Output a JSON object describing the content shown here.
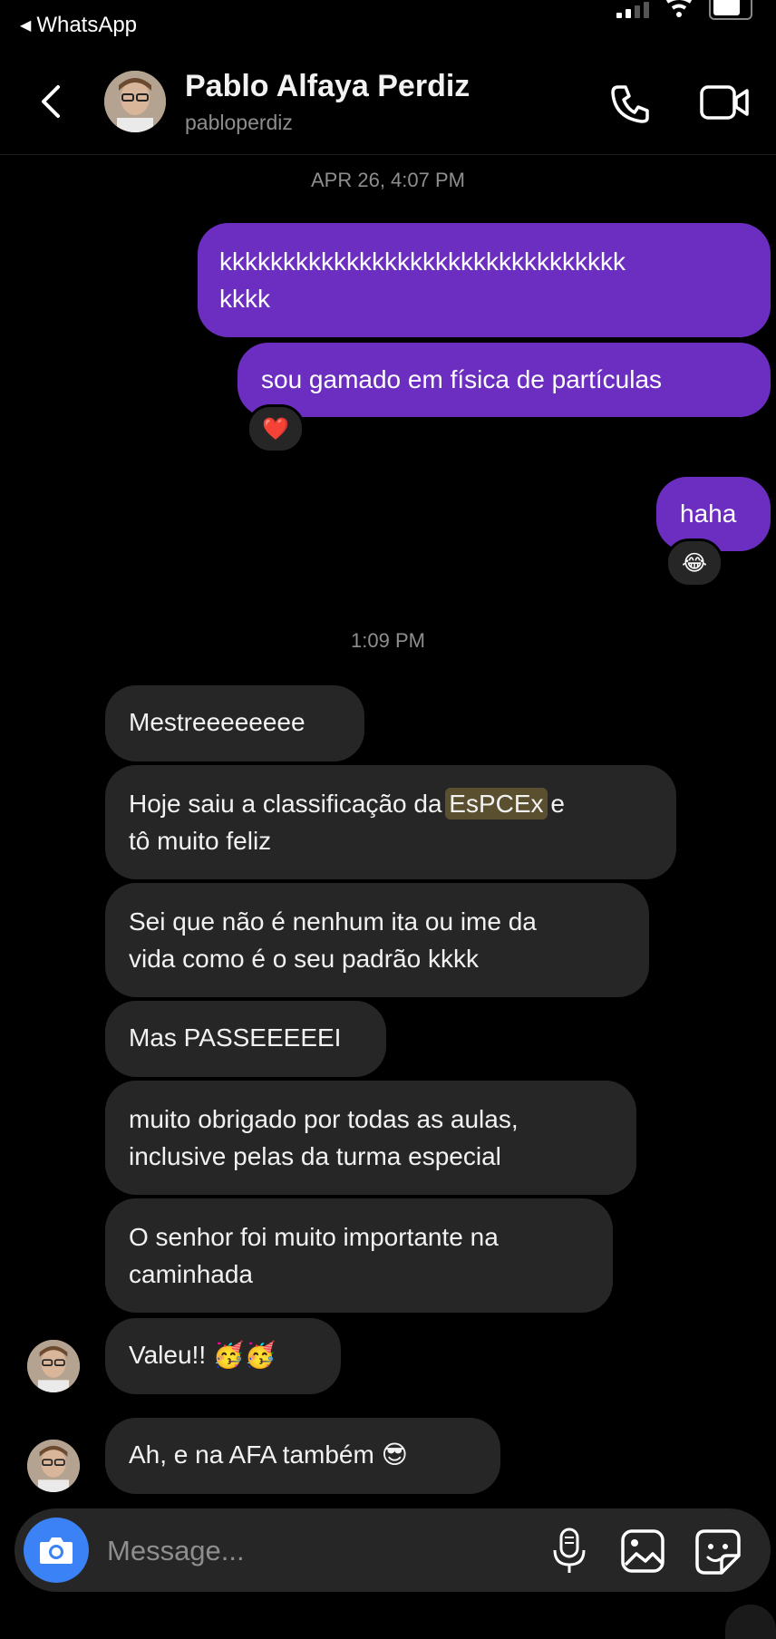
{
  "status_bar": {
    "back_app": "WhatsApp"
  },
  "header": {
    "name": "Pablo Alfaya Perdiz",
    "username": "pabloperdiz"
  },
  "timestamps": {
    "first": "APR 26, 4:07 PM",
    "second": "1:09 PM"
  },
  "outgoing": [
    {
      "text_line1": "kkkkkkkkkkkkkkkkkkkkkkkkkkkkkkkk",
      "text_line2": "kkkk"
    },
    {
      "text": "sou gamado em física de partículas",
      "reaction": "❤️"
    },
    {
      "text": "haha",
      "reaction": "😂"
    }
  ],
  "incoming": [
    {
      "text": "Mestreeeeeeee"
    },
    {
      "text_before": "Hoje saiu a classificação da ",
      "highlight": "EsPCEx",
      "text_after": " e",
      "text_line2": "tô muito feliz"
    },
    {
      "text_line1": "Sei que não é nenhum ita ou ime da",
      "text_line2": "vida como é o seu padrão kkkk"
    },
    {
      "text": "Mas PASSEEEEEI"
    },
    {
      "text_line1": "muito obrigado por todas as aulas,",
      "text_line2": "inclusive pelas da turma especial"
    },
    {
      "text_line1": "O senhor foi muito importante na",
      "text_line2": "caminhada"
    },
    {
      "text": "Valeu!! 🥳🥳"
    },
    {
      "text": "Ah, e na AFA também 😎"
    }
  ],
  "composer": {
    "placeholder": "Message..."
  },
  "colors": {
    "outgoing_bubble": "#6c2ec0",
    "incoming_bubble": "#262626",
    "camera_button": "#3b82f6"
  }
}
